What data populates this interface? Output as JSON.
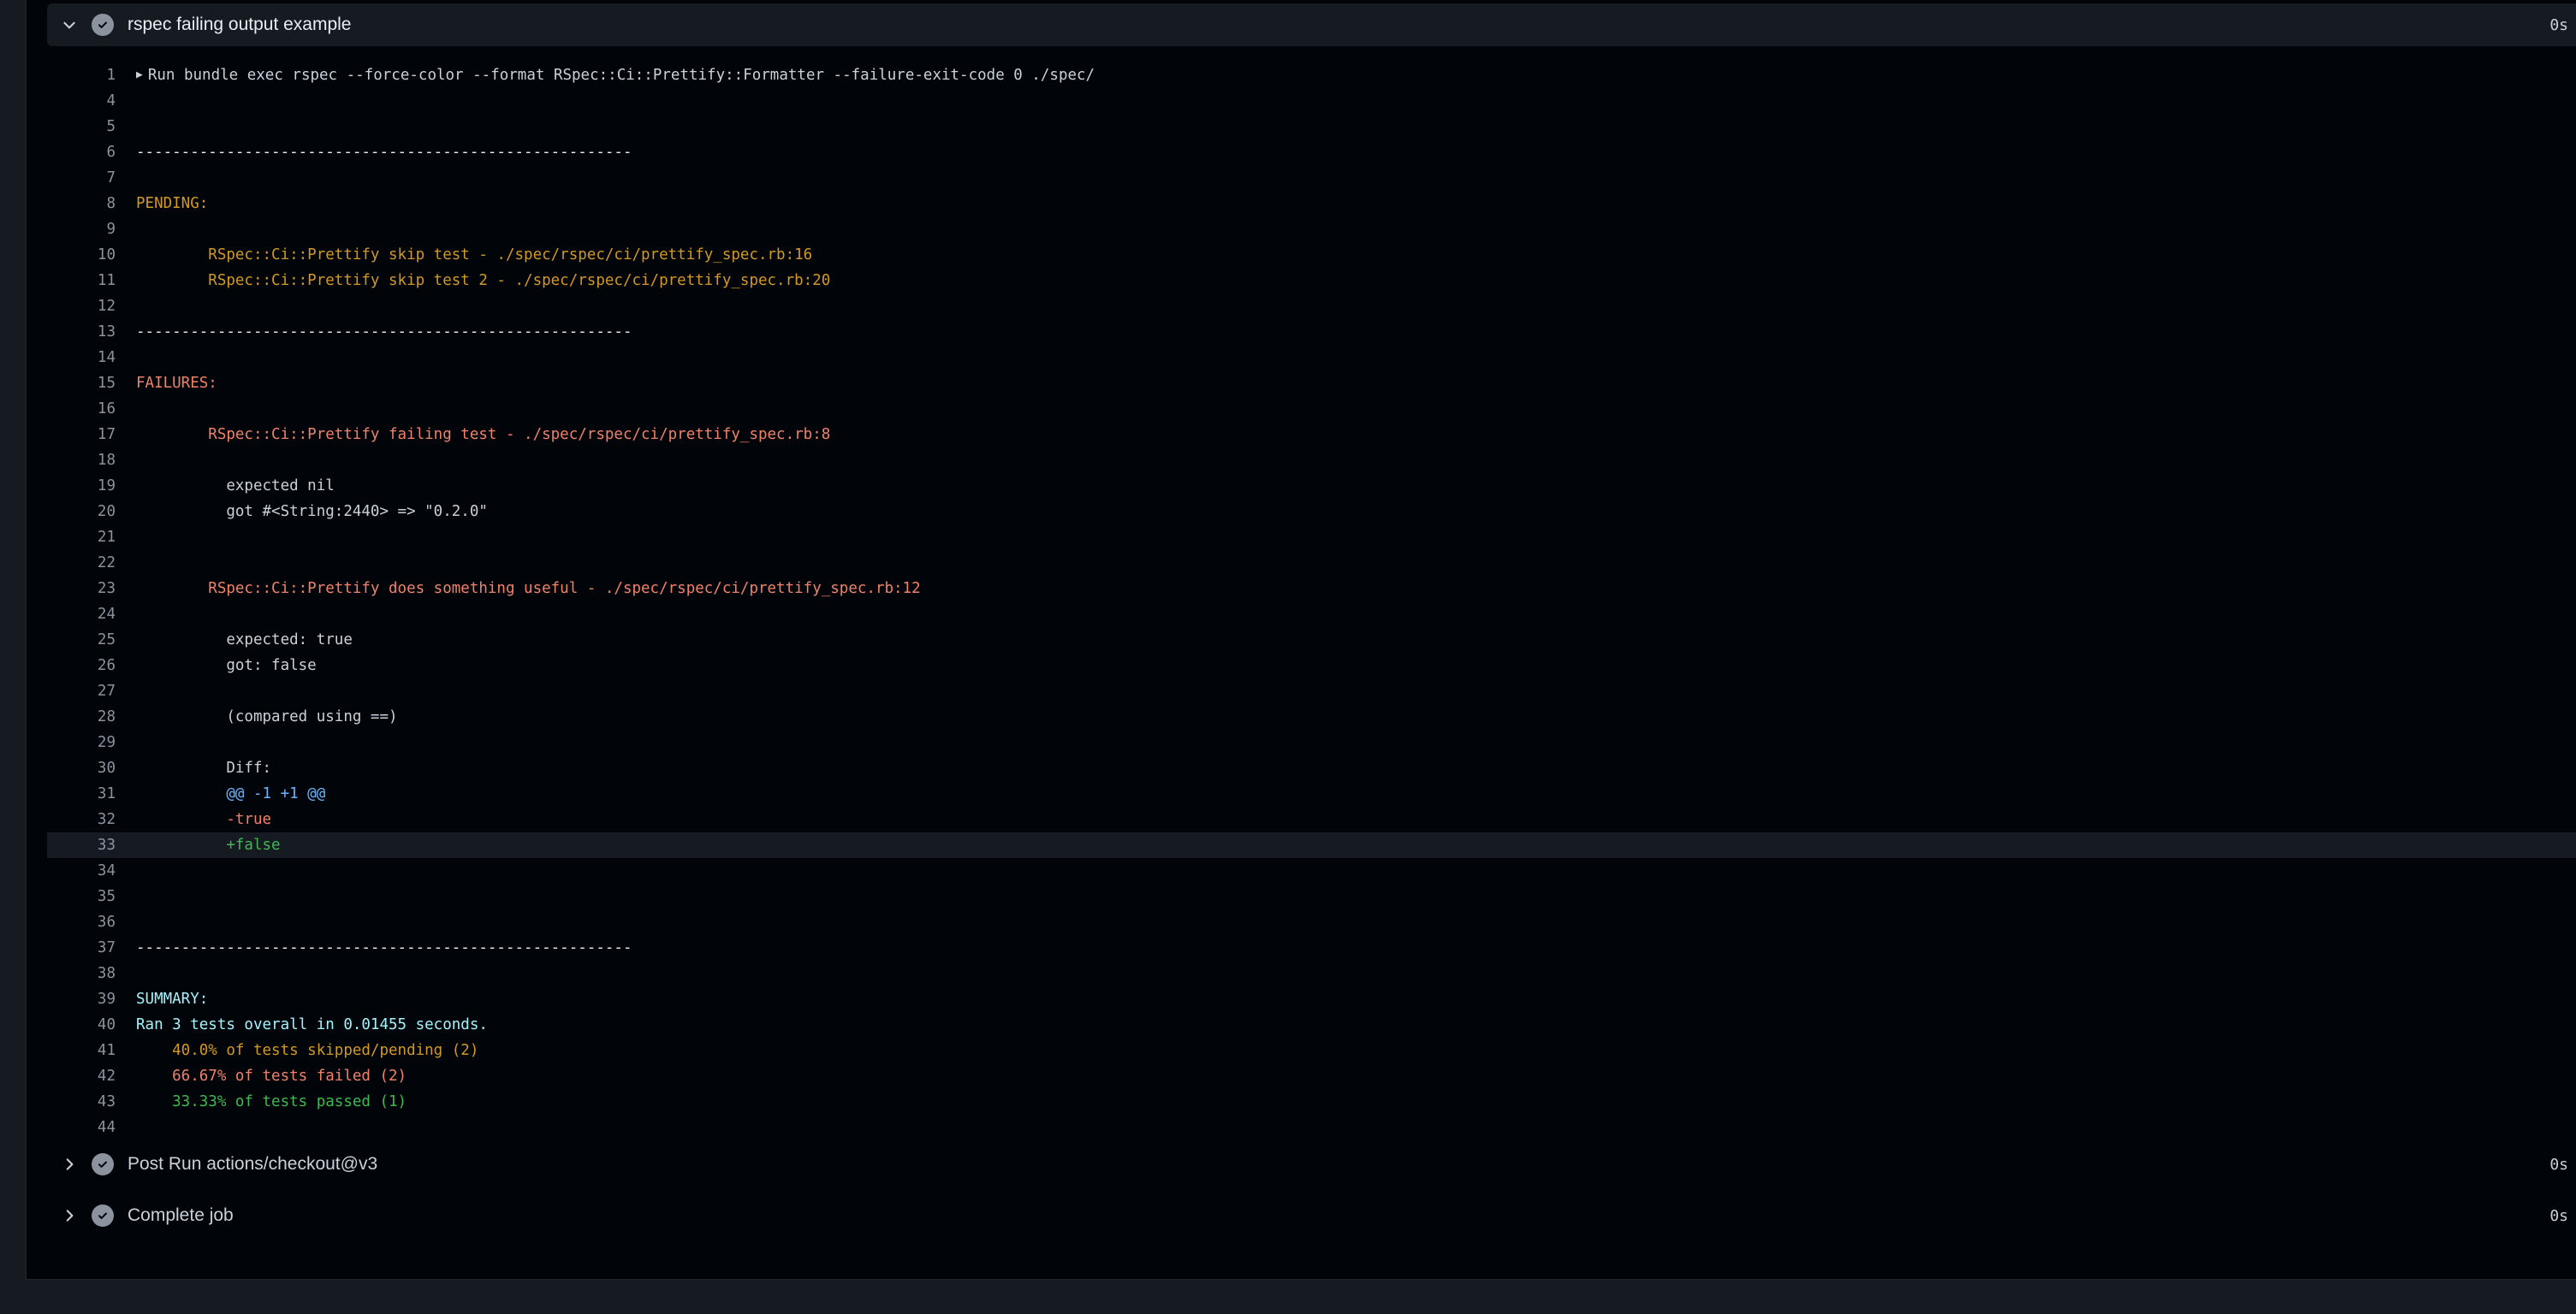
{
  "colors": {
    "page_bg": "#161b22",
    "panel_bg": "#010409",
    "header_bg": "#161b22",
    "line_number": "#8b949e",
    "default_text": "#c9d1d9",
    "yellow": "#d29922",
    "red": "#f0826a",
    "blue": "#6cb6ff",
    "green": "#3fb950",
    "cyan": "#a5f3fc"
  },
  "steps": {
    "current": {
      "title": "rspec failing output example",
      "duration": "0s",
      "expanded": true,
      "icon": "check-circle-icon"
    },
    "post_checkout": {
      "title": "Post Run actions/checkout@v3",
      "duration": "0s",
      "expanded": false,
      "icon": "check-circle-icon"
    },
    "complete_job": {
      "title": "Complete job",
      "duration": "0s",
      "expanded": false,
      "icon": "check-circle-icon"
    }
  },
  "log_lines": [
    {
      "n": "1",
      "text": "Run bundle exec rspec --force-color --format RSpec::Ci::Prettify::Formatter --failure-exit-code 0 ./spec/",
      "color": "default",
      "group": true
    },
    {
      "n": "4",
      "text": "",
      "color": "default"
    },
    {
      "n": "5",
      "text": "",
      "color": "default"
    },
    {
      "n": "6",
      "text": "-------------------------------------------------------",
      "color": "white"
    },
    {
      "n": "7",
      "text": "",
      "color": "default"
    },
    {
      "n": "8",
      "text": "PENDING:",
      "color": "yellow"
    },
    {
      "n": "9",
      "text": "",
      "color": "default"
    },
    {
      "n": "10",
      "text": "        RSpec::Ci::Prettify skip test - ./spec/rspec/ci/prettify_spec.rb:16",
      "color": "yellow"
    },
    {
      "n": "11",
      "text": "        RSpec::Ci::Prettify skip test 2 - ./spec/rspec/ci/prettify_spec.rb:20",
      "color": "yellow"
    },
    {
      "n": "12",
      "text": "",
      "color": "default"
    },
    {
      "n": "13",
      "text": "-------------------------------------------------------",
      "color": "white"
    },
    {
      "n": "14",
      "text": "",
      "color": "default"
    },
    {
      "n": "15",
      "text": "FAILURES:",
      "color": "red"
    },
    {
      "n": "16",
      "text": "",
      "color": "default"
    },
    {
      "n": "17",
      "text": "        RSpec::Ci::Prettify failing test - ./spec/rspec/ci/prettify_spec.rb:8",
      "color": "red"
    },
    {
      "n": "18",
      "text": "",
      "color": "default"
    },
    {
      "n": "19",
      "text": "          expected nil",
      "color": "default"
    },
    {
      "n": "20",
      "text": "          got #<String:2440> => \"0.2.0\"",
      "color": "default"
    },
    {
      "n": "21",
      "text": "",
      "color": "default"
    },
    {
      "n": "22",
      "text": "",
      "color": "default"
    },
    {
      "n": "23",
      "text": "        RSpec::Ci::Prettify does something useful - ./spec/rspec/ci/prettify_spec.rb:12",
      "color": "red"
    },
    {
      "n": "24",
      "text": "",
      "color": "default"
    },
    {
      "n": "25",
      "text": "          expected: true",
      "color": "default"
    },
    {
      "n": "26",
      "text": "          got: false",
      "color": "default"
    },
    {
      "n": "27",
      "text": "",
      "color": "default"
    },
    {
      "n": "28",
      "text": "          (compared using ==)",
      "color": "default"
    },
    {
      "n": "29",
      "text": "",
      "color": "default"
    },
    {
      "n": "30",
      "text": "          Diff:",
      "color": "default"
    },
    {
      "n": "31",
      "text": "          @@ -1 +1 @@",
      "color": "blue"
    },
    {
      "n": "32",
      "text": "          -true",
      "color": "red"
    },
    {
      "n": "33",
      "text": "          +false",
      "color": "green",
      "highlight": true
    },
    {
      "n": "34",
      "text": "",
      "color": "default"
    },
    {
      "n": "35",
      "text": "",
      "color": "default"
    },
    {
      "n": "36",
      "text": "",
      "color": "default"
    },
    {
      "n": "37",
      "text": "-------------------------------------------------------",
      "color": "white"
    },
    {
      "n": "38",
      "text": "",
      "color": "default"
    },
    {
      "n": "39",
      "text": "SUMMARY:",
      "color": "cyan"
    },
    {
      "n": "40",
      "text": "Ran 3 tests overall in 0.01455 seconds.",
      "color": "cyan"
    },
    {
      "n": "41",
      "text": "    40.0% of tests skipped/pending (2)",
      "color": "yellow"
    },
    {
      "n": "42",
      "text": "    66.67% of tests failed (2)",
      "color": "red"
    },
    {
      "n": "43",
      "text": "    33.33% of tests passed (1)",
      "color": "green"
    },
    {
      "n": "44",
      "text": "",
      "color": "default"
    }
  ]
}
